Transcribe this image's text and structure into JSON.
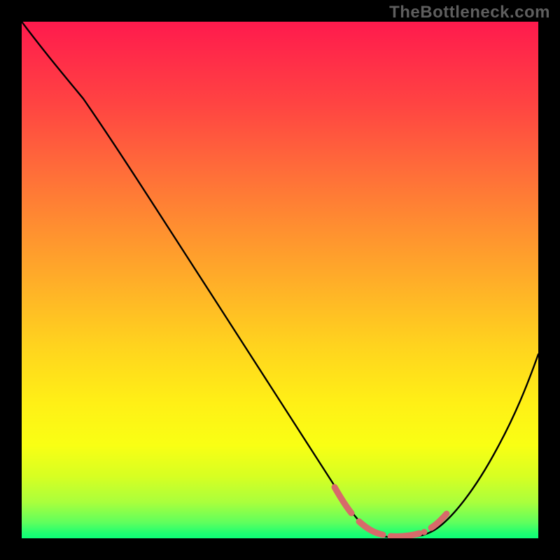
{
  "watermark": "TheBottleneck.com",
  "colors": {
    "dash": "#d76a6a"
  },
  "chart_data": {
    "type": "line",
    "title": "",
    "xlabel": "",
    "ylabel": "",
    "xlim": [
      0,
      100
    ],
    "ylim": [
      0,
      100
    ],
    "grid": false,
    "series": [
      {
        "name": "bottleneck-curve",
        "x": [
          0,
          5,
          10,
          15,
          20,
          25,
          30,
          35,
          40,
          45,
          50,
          55,
          60,
          63,
          66,
          69,
          72,
          75,
          78,
          81,
          84,
          88,
          92,
          96,
          100
        ],
        "values": [
          100,
          97,
          92,
          85,
          77,
          69,
          61,
          53,
          45,
          37,
          29,
          21,
          13,
          8,
          4,
          2,
          1,
          1,
          1,
          2,
          4,
          9,
          17,
          27,
          40
        ]
      }
    ],
    "highlight": {
      "name": "sweet-spot-highlight",
      "x_start": 60,
      "x_end": 81,
      "approx_y": 2
    }
  }
}
